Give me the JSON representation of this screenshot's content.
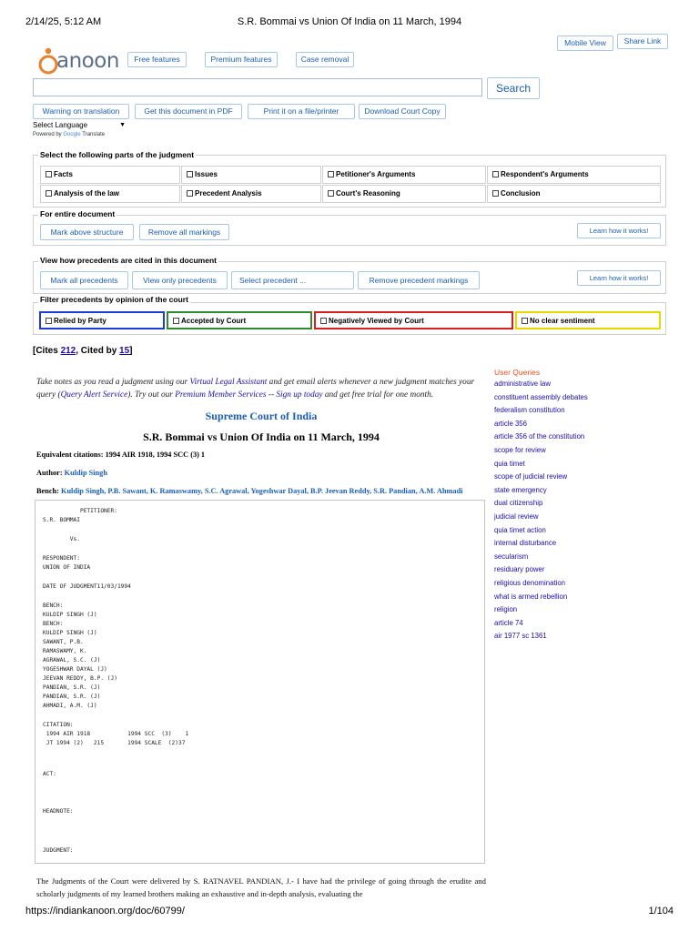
{
  "print_header": {
    "datetime": "2/14/25, 5:12 AM",
    "page_title": "S.R. Bommai vs Union Of India on 11 March, 1994"
  },
  "print_footer": {
    "url": "https://indiankanoon.org/doc/60799/",
    "page": "1/104"
  },
  "logo": {
    "text": "anoon"
  },
  "top_nav": {
    "free_features": "Free features",
    "premium_features": "Premium features",
    "case_removal": "Case removal",
    "mobile_view": "Mobile View",
    "share_link": "Share Link"
  },
  "search": {
    "value": "",
    "button": "Search"
  },
  "doc_actions": {
    "warning": "Warning on translation",
    "pdf": "Get this document in PDF",
    "print": "Print it on a file/printer",
    "copy": "Download Court Copy"
  },
  "language": {
    "select": "Select Language",
    "powered_by": "Powered by",
    "google": "Google",
    "translate": "Translate"
  },
  "judgment_parts": {
    "legend": "Select the following parts of the judgment",
    "options": [
      "Facts",
      "Issues",
      "Petitioner's Arguments",
      "Respondent's Arguments",
      "Analysis of the law",
      "Precedent Analysis",
      "Court's Reasoning",
      "Conclusion"
    ]
  },
  "entire_doc": {
    "legend": "For entire document",
    "mark": "Mark above structure",
    "remove": "Remove all markings",
    "learn": "Learn how it works!"
  },
  "precedents": {
    "legend": "View how precedents are cited in this document",
    "mark_all": "Mark all precedents",
    "view_only": "View only precedents",
    "select": "Select precedent ...",
    "remove": "Remove precedent markings",
    "learn": "Learn how it works!"
  },
  "filter": {
    "legend": "Filter precedents by opinion of the court",
    "options": [
      "Relied by Party",
      "Accepted by Court",
      "Negatively Viewed by Court",
      "No clear sentiment"
    ],
    "colors": [
      "#1f3ed6",
      "#2e8b2e",
      "#d42020",
      "#e8d800"
    ]
  },
  "cites": {
    "prefix": "[Cites ",
    "cites_count": "212",
    "mid": ", Cited by ",
    "cited_count": "15",
    "suffix": "]"
  },
  "notice": {
    "p1": "Take notes as you read a judgment using our ",
    "virtual": "Virtual Legal Assistant",
    "p2": " and get email alerts whenever a new judgment matches your query (",
    "alert": "Query Alert Service",
    "p3": "). Try out our ",
    "premium": "Premium Member Services",
    "p4": " -- ",
    "signup": "Sign up today",
    "p5": " and get free trial for one month."
  },
  "document": {
    "court": "Supreme Court of India",
    "title": "S.R. Bommai vs Union Of India on 11 March, 1994",
    "equiv_label": "Equivalent citations:",
    "equiv_value": "1994 AIR 1918, 1994 SCC (3) 1",
    "author_label": "Author:",
    "author_value": "Kuldip Singh",
    "bench_label": "Bench:",
    "bench_value": "Kuldip Singh, P.B. Sawant, K. Ramaswamy, S.C. Agrawal, Yogeshwar Dayal, B.P. Jeevan Reddy, S.R. Pandian, A.M. Ahmadi"
  },
  "pre_lines": [
    "           PETITIONER:",
    "S.R. BOMMAI",
    "        Vs.",
    "RESPONDENT:",
    "UNION OF INDIA",
    "DATE OF JUDGMENT11/03/1994",
    "BENCH:",
    "KULDIP SINGH (J)",
    "BENCH:",
    "KULDIP SINGH (J)",
    "SAWANT, P.B.",
    "RAMASWAMY, K.",
    "AGRAWAL, S.C. (J)",
    "YOGESHWAR DAYAL (J)",
    "JEEVAN REDDY, B.P. (J)",
    "PANDIAN, S.R. (J)",
    "PANDIAN, S.R. (J)",
    "AHMADI, A.M. (J)",
    "CITATION:",
    " 1994 AIR 1918           1994 SCC  (3)    1",
    " JT 1994 (2)   215       1994 SCALE  (2)37",
    "ACT:",
    "HEADNOTE:",
    "JUDGMENT:"
  ],
  "body_text": "The Judgments of the Court were delivered by S. RATNAVEL PANDIAN, J.- I have had the privilege of going through the erudite and scholarly judgments of my learned brothers making an exhaustive and in-depth analysis, evaluating the",
  "user_queries": {
    "heading": "User Queries",
    "items": [
      "administrative law",
      "constituent assembly debates",
      "federalism constitution",
      "article 356",
      "article 356 of the constitution",
      "scope for review",
      "quia timet",
      "scope of judicial review",
      "state emergency",
      "dual citizenship",
      "judicial review",
      "quia timet action",
      "internal disturbance",
      "secularism",
      "residuary power",
      "religious denomination",
      "what is armed rebellion",
      "religion",
      "article 74",
      "air 1977 sc 1361"
    ]
  }
}
